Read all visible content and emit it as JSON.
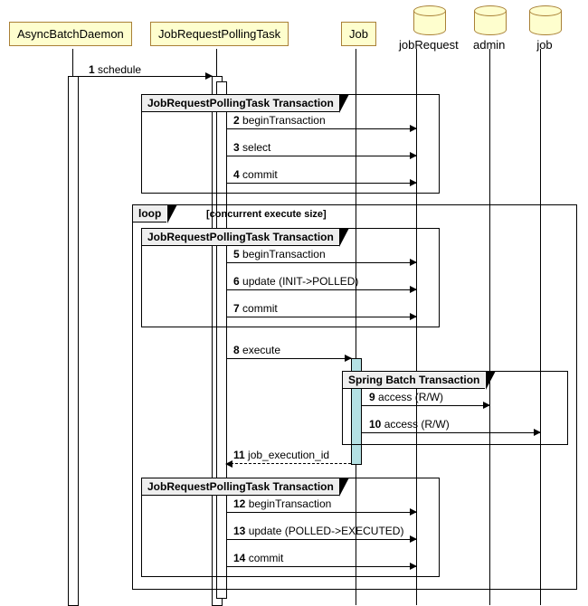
{
  "participants": {
    "p1": "AsyncBatchDaemon",
    "p2": "JobRequestPollingTask",
    "p3": "Job",
    "db1": "jobRequest",
    "db2": "admin",
    "db3": "job"
  },
  "frames": {
    "f1": "JobRequestPollingTask Transaction",
    "loop": "loop",
    "loop_cond": "[concurrent execute size]",
    "f2": "JobRequestPollingTask Transaction",
    "f3": "Spring Batch Transaction",
    "f4": "JobRequestPollingTask Transaction"
  },
  "messages": {
    "m1": {
      "n": "1",
      "t": "schedule"
    },
    "m2": {
      "n": "2",
      "t": "beginTransaction"
    },
    "m3": {
      "n": "3",
      "t": "select"
    },
    "m4": {
      "n": "4",
      "t": "commit"
    },
    "m5": {
      "n": "5",
      "t": "beginTransaction"
    },
    "m6": {
      "n": "6",
      "t": "update (INIT->POLLED)"
    },
    "m7": {
      "n": "7",
      "t": "commit"
    },
    "m8": {
      "n": "8",
      "t": "execute"
    },
    "m9": {
      "n": "9",
      "t": "access (R/W)"
    },
    "m10": {
      "n": "10",
      "t": "access (R/W)"
    },
    "m11": {
      "n": "11",
      "t": "job_execution_id"
    },
    "m12": {
      "n": "12",
      "t": "beginTransaction"
    },
    "m13": {
      "n": "13",
      "t": "update (POLLED->EXECUTED)"
    },
    "m14": {
      "n": "14",
      "t": "commit"
    }
  }
}
